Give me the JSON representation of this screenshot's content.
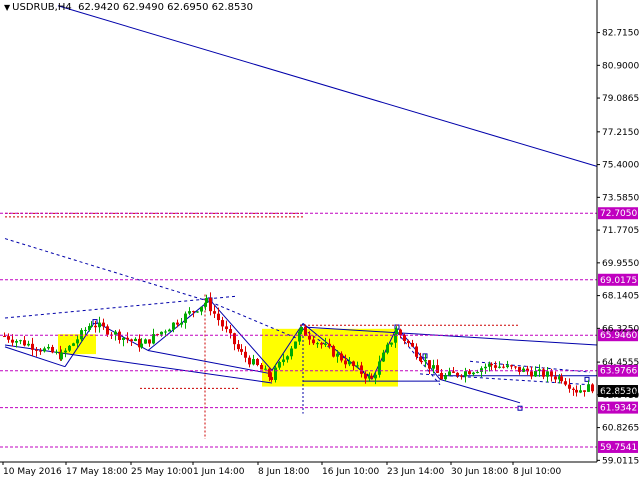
{
  "header": {
    "symbol": "USDRUB,H4",
    "ohlc": "62.9420 62.9490 62.6950 62.8530"
  },
  "chart_data": {
    "type": "candlestick",
    "title": "USDRUB,H4",
    "ylim": [
      58.92,
      84.52
    ],
    "y_ticks": [
      "82.7150",
      "80.9000",
      "79.0865",
      "77.2150",
      "75.4000",
      "73.5850",
      "71.7705",
      "69.9550",
      "68.1405",
      "66.3250",
      "64.4555",
      "62.6410",
      "60.8265",
      "59.0115"
    ],
    "x_ticks": [
      "10 May 2016",
      "17 May 18:00",
      "25 May 10:00",
      "1 Jun 14:00",
      "8 Jun 18:00",
      "16 Jun 10:00",
      "23 Jun 14:00",
      "30 Jun 18:00",
      "8 Jul 10:00"
    ],
    "levels": [
      {
        "price": 72.705,
        "label": "72.7050",
        "color": "#c000c0"
      },
      {
        "price": 69.0175,
        "label": "69.0175",
        "color": "#c000c0"
      },
      {
        "price": 65.946,
        "label": "65.9460",
        "color": "#c000c0"
      },
      {
        "price": 63.9766,
        "label": "63.9766",
        "color": "#c000c0"
      },
      {
        "price": 61.9342,
        "label": "61.9342",
        "color": "#c000c0"
      },
      {
        "price": 59.7541,
        "label": "59.7541",
        "color": "#c000c0"
      }
    ],
    "current_price": {
      "price": 62.853,
      "label": "62.8530"
    },
    "colors": {
      "bull": "#00aa00",
      "bear": "#dd0000",
      "trend": "#0000aa",
      "level": "#c000c0",
      "box": "#ffff00",
      "axis_bg": "#ffffff",
      "current_bg": "#000000"
    }
  }
}
